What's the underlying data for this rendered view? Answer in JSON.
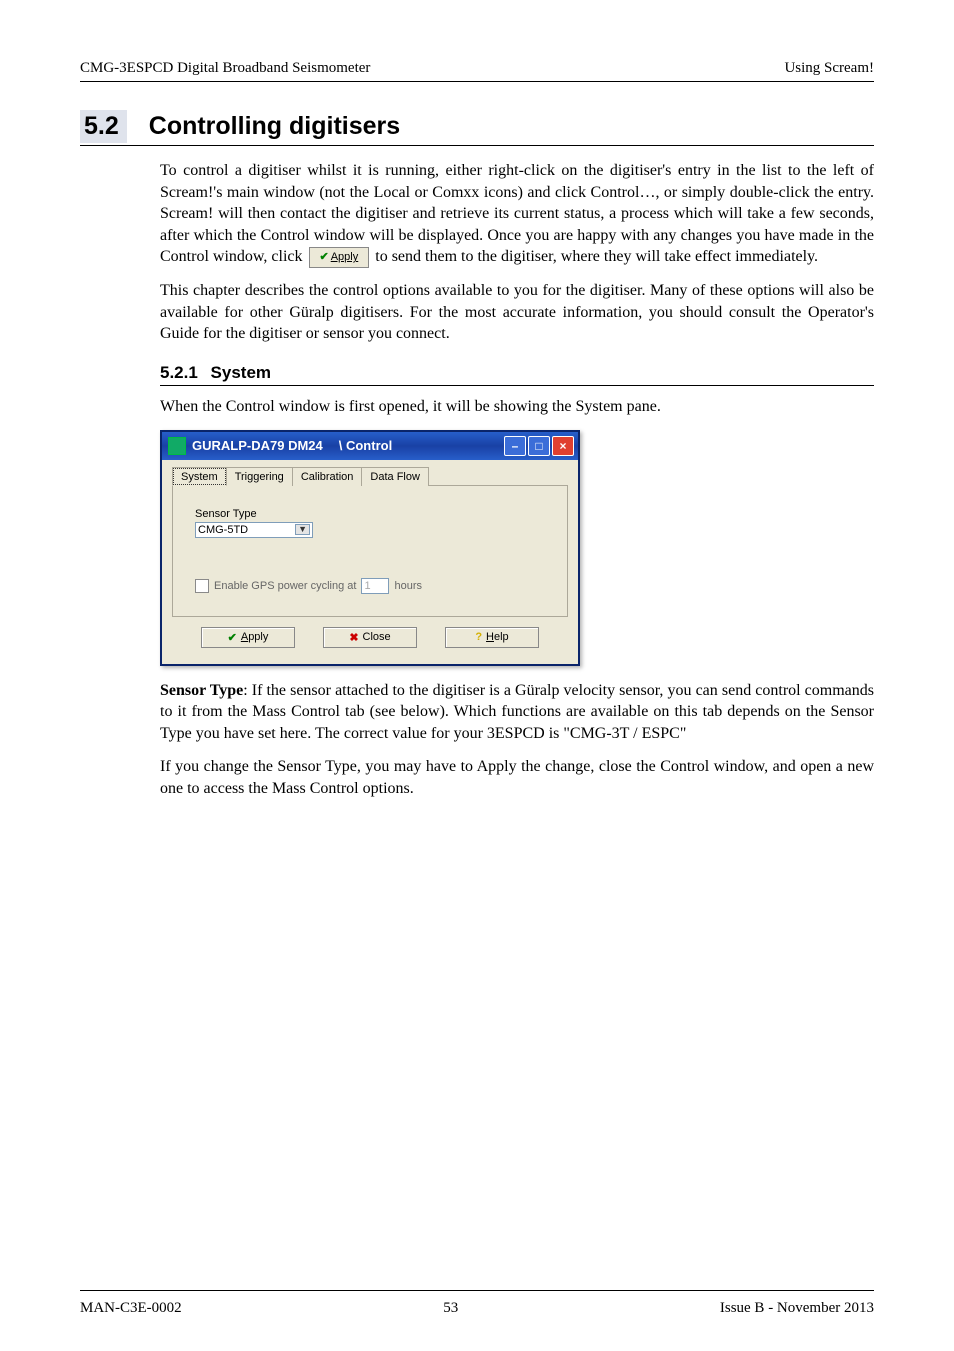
{
  "header": {
    "left": "CMG-3ESPCD Digital Broadband Seismometer",
    "right": "Using Scream!"
  },
  "section": {
    "number": "5.2",
    "title": "Controlling digitisers"
  },
  "paragraphs": {
    "p1a": "To control a digitiser whilst it is running, either right-click on the digitiser's entry in the list to the left of Scream!'s main window (not the Local or Comxx icons) and click Control…, or simply double-click the entry.  Scream! will then contact the digitiser and retrieve its current status, a process which will take a few seconds, after which the Control window will be displayed.  Once you are happy with any changes you have made in the Control window, click ",
    "apply_inline": "Apply",
    "p1b": " to send them to the digitiser, where they will take effect immediately.",
    "p2": "This chapter describes the control options available to you for the digitiser.  Many of these options will also be available for other Güralp digitisers.  For the most accurate information, you should consult the Operator's Guide for the digitiser or sensor you connect.",
    "p3": "When the Control window is first opened, it will be showing the System pane.",
    "p4_before_bold": "",
    "p4_bold": "Sensor Type",
    "p4_after_bold": ": If the sensor attached to the digitiser is a Güralp velocity sensor, you can send control commands to it from the Mass Control tab (see below).  Which functions are available on this tab depends on the Sensor Type you have set here.  The correct value for your 3ESPCD is \"CMG-3T / ESPC\"",
    "p5": "If you change the Sensor Type, you may have to Apply the change, close the Control window, and open a new one to access the Mass Control options."
  },
  "subsection": {
    "number": "5.2.1",
    "title": "System"
  },
  "dialog": {
    "title_main": "GURALP-DA79 DM24",
    "title_sub": "\\ Control",
    "tabs": [
      {
        "label": "System",
        "active": true
      },
      {
        "label": "Triggering",
        "active": false
      },
      {
        "label": "Calibration",
        "active": false
      },
      {
        "label": "Data Flow",
        "active": false
      }
    ],
    "sensor_type_label": "Sensor Type",
    "sensor_type_value": "CMG-5TD",
    "gps_text_before": "Enable GPS power cycling at",
    "gps_value": "1",
    "gps_text_after": "hours",
    "buttons": {
      "apply": "Apply",
      "close": "Close",
      "help": "Help"
    }
  },
  "footer": {
    "left": "MAN-C3E-0002",
    "center": "53",
    "right": "Issue B  - November 2013"
  },
  "chart_data": null
}
